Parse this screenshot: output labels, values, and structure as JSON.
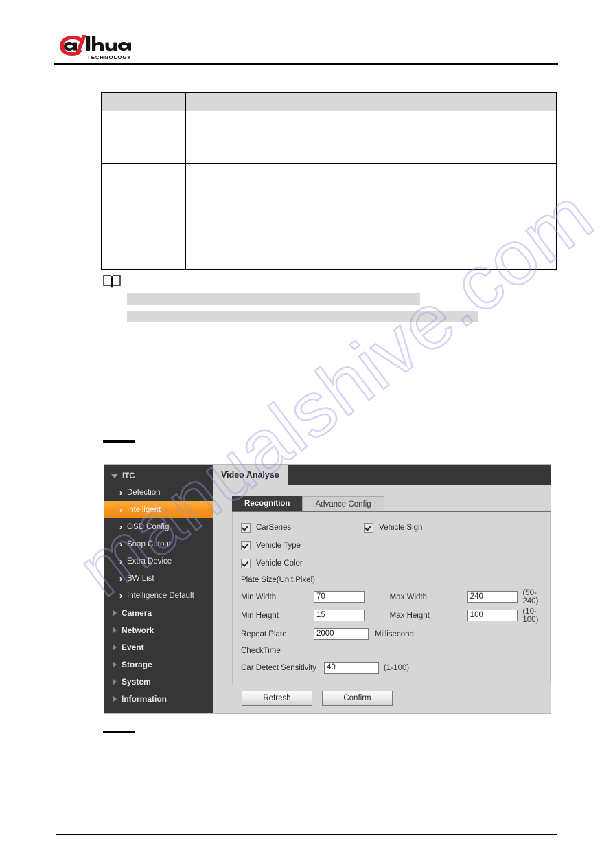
{
  "document": {
    "logo": {
      "brand": "alhua",
      "sub": "TECHNOLOGY"
    },
    "spec_table": {
      "header": [
        "",
        ""
      ],
      "rows": [
        [
          "",
          ""
        ],
        [
          "",
          ""
        ]
      ]
    },
    "note_icon": "note-book-icon",
    "redactions": {
      "grey_bar_1": "",
      "grey_bar_2": "",
      "black_bar_1": "",
      "black_bar_2": ""
    },
    "watermark": "manualshive.com"
  },
  "device_ui": {
    "sidebar": {
      "root": {
        "label": "ITC",
        "expanded": true
      },
      "children": [
        {
          "label": "Detection",
          "active": false
        },
        {
          "label": "Intelligent",
          "active": true
        },
        {
          "label": "OSD Config",
          "active": false
        },
        {
          "label": "Snap Cutout",
          "active": false
        },
        {
          "label": "Extra Device",
          "active": false
        },
        {
          "label": "BW List",
          "active": false
        },
        {
          "label": "Intelligence Default",
          "active": false
        }
      ],
      "groups": [
        {
          "label": "Camera"
        },
        {
          "label": "Network"
        },
        {
          "label": "Event"
        },
        {
          "label": "Storage"
        },
        {
          "label": "System"
        },
        {
          "label": "Information"
        }
      ],
      "accent_color": "#f79420",
      "background_color": "#363636"
    },
    "pane": {
      "title": "Video Analyse",
      "tabs": [
        {
          "label": "Recognition",
          "active": true
        },
        {
          "label": "Advance Config",
          "active": false
        }
      ]
    },
    "form": {
      "checkboxes": [
        {
          "label": "CarSeries",
          "checked": true
        },
        {
          "label": "Vehicle Sign",
          "checked": true
        },
        {
          "label": "Vehicle Type",
          "checked": true
        },
        {
          "label": "Vehicle Color",
          "checked": true
        }
      ],
      "plate_size_label": "Plate Size(Unit:Pixel)",
      "fields": {
        "min_width": {
          "label": "Min Width",
          "value": "70"
        },
        "max_width": {
          "label": "Max Width",
          "value": "240",
          "hint": "(50-240)"
        },
        "min_height": {
          "label": "Min Height",
          "value": "15"
        },
        "max_height": {
          "label": "Max Height",
          "value": "100",
          "hint": "(10-100)"
        },
        "repeat_plate_1": {
          "label": "Repeat Plate",
          "value": "2000",
          "unit": "Millisecond"
        },
        "repeat_plate_2": {
          "label": "CheckTime"
        },
        "car_detect_sensitivity": {
          "label": "Car Detect Sensitivity",
          "value": "40",
          "hint": "(1-100)"
        }
      }
    },
    "buttons": {
      "refresh": "Refresh",
      "confirm": "Confirm"
    }
  }
}
